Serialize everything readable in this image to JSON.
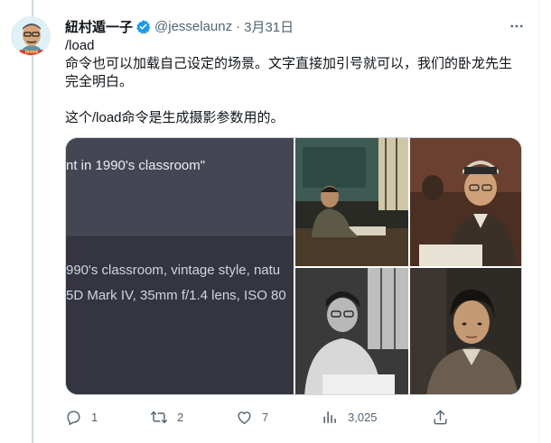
{
  "tweet": {
    "author_name": "紐村遁一子",
    "handle": "@jesselaunz",
    "separator": "·",
    "date": "3月31日",
    "text_lines": [
      "/load",
      "命令也可以加载自己设定的场景。文字直接加引号就可以，我们的卧龙先生",
      "完全明白。",
      "",
      "这个/load命令是生成摄影参数用的。"
    ]
  },
  "media": {
    "screenshot_lines": [
      "nt in 1990's classroom\"",
      "990's classroom, vintage style, natu",
      "5D Mark IV, 35mm f/1.4 lens, ISO 80"
    ],
    "photos": [
      "student-writing-classroom",
      "student-glasses-cap",
      "student-glasses-bw",
      "student-portrait-bw"
    ]
  },
  "actions": {
    "reply_count": "1",
    "retweet_count": "2",
    "like_count": "7",
    "views_count": "3,025"
  },
  "colors": {
    "verified": "#1d9bf0",
    "secondary_text": "#536471",
    "chat_background": "#40414f"
  }
}
